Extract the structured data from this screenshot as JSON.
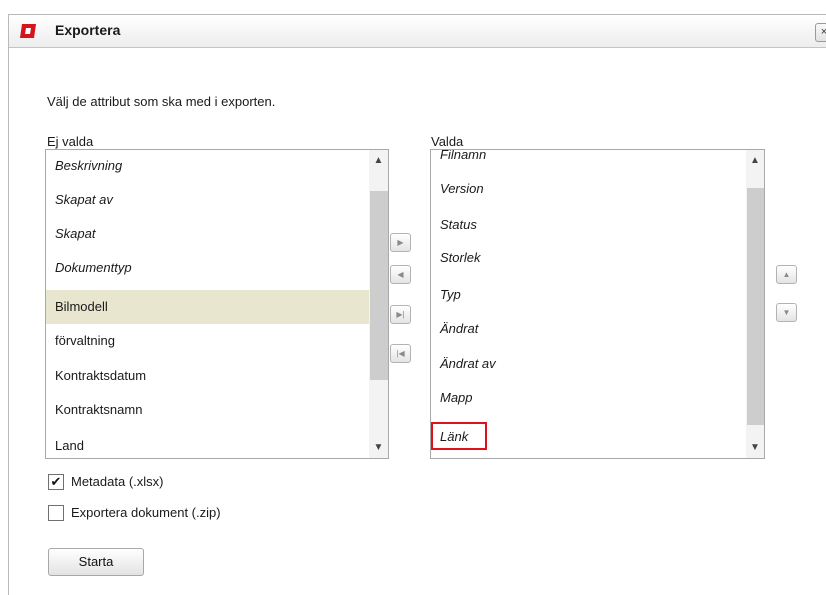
{
  "window": {
    "title": "Exportera",
    "close_label": "×"
  },
  "instruction": "Välj de attribut som ska med i exporten.",
  "unselected": {
    "label": "Ej valda",
    "items": [
      {
        "label": "Beskrivning",
        "italic": true,
        "selected": false
      },
      {
        "label": "Skapat av",
        "italic": true,
        "selected": false
      },
      {
        "label": "Skapat",
        "italic": true,
        "selected": false
      },
      {
        "label": "Dokumenttyp",
        "italic": true,
        "selected": false
      },
      {
        "label": "Bilmodell",
        "italic": false,
        "selected": true
      },
      {
        "label": "förvaltning",
        "italic": false,
        "selected": false
      },
      {
        "label": "Kontraktsdatum",
        "italic": false,
        "selected": false
      },
      {
        "label": "Kontraktsnamn",
        "italic": false,
        "selected": false
      },
      {
        "label": "Land",
        "italic": false,
        "selected": false
      }
    ]
  },
  "selected": {
    "label": "Valda",
    "items": [
      {
        "label": "Filnamn",
        "italic": true,
        "highlight": false
      },
      {
        "label": "Version",
        "italic": true,
        "highlight": false
      },
      {
        "label": "Status",
        "italic": true,
        "highlight": false
      },
      {
        "label": "Storlek",
        "italic": true,
        "highlight": false
      },
      {
        "label": "Typ",
        "italic": true,
        "highlight": false
      },
      {
        "label": "Ändrat",
        "italic": true,
        "highlight": false
      },
      {
        "label": "Ändrat av",
        "italic": true,
        "highlight": false
      },
      {
        "label": "Mapp",
        "italic": true,
        "highlight": false
      },
      {
        "label": "Länk",
        "italic": true,
        "highlight": true
      }
    ]
  },
  "transfer_buttons": {
    "add": "▶",
    "remove": "◀",
    "add_all": "▶|",
    "remove_all": "|◀"
  },
  "order_buttons": {
    "up": "▲",
    "down": "▼"
  },
  "scroll_arrows": {
    "up": "▲",
    "down": "▼"
  },
  "options": {
    "metadata": {
      "label": "Metadata (.xlsx)",
      "checked": true,
      "check_mark": "✔"
    },
    "documents": {
      "label": "Exportera dokument (.zip)",
      "checked": false
    }
  },
  "start_button": "Starta",
  "colors": {
    "logo_red": "#d6141e",
    "selected_row": "#e8e6cf",
    "highlight_border": "#e0101a"
  }
}
